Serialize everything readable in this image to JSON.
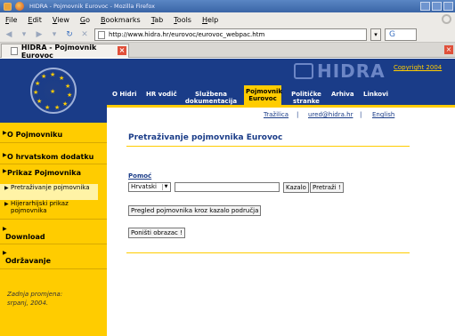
{
  "window": {
    "title": "HIDRA - Pojmovnik Eurovoc - Mozilla Firefox"
  },
  "menubar": {
    "items": [
      "File",
      "Edit",
      "View",
      "Go",
      "Bookmarks",
      "Tab",
      "Tools",
      "Help"
    ]
  },
  "navbar": {
    "url": "http://www.hidra.hr/eurovoc/eurovoc_webpac.htm"
  },
  "tab": {
    "title": "HIDRA - Pojmovnik Eurovoc"
  },
  "header": {
    "logo_text": "HIDRA",
    "copyright": "Copyright 2004",
    "nav": [
      "O Hidri",
      "HR vodič",
      "Službena dokumentacija",
      "Pojmovnik Eurovoc",
      "Političke stranke",
      "Arhiva",
      "Linkovi"
    ],
    "sublinks": [
      "Tražilica",
      "|",
      "ured@hidra.hr",
      "|",
      "English"
    ]
  },
  "sidebar": {
    "items": [
      "O Pojmovniku",
      "O hrvatskom dodatku",
      "Prikaz Pojmovnika",
      "Download",
      "Održavanje"
    ],
    "subitems": [
      "Pretraživanje pojmovnika",
      "Hijerarhijski prikaz pojmovnika"
    ],
    "note_line1": "Zadnja promjena:",
    "note_line2": "srpanj, 2004."
  },
  "main": {
    "title": "Pretraživanje pojmovnika Eurovoc",
    "help_link": "Pomoć",
    "language_select": "Hrvatski",
    "search_value": "",
    "kazalo_button": "Kazalo",
    "search_button": "Pretraži !",
    "browse_button": "Pregled pojmovnika kroz kazalo područja",
    "reset_button": "Poništi obrazac !"
  },
  "colors": {
    "brand_blue": "#1a3c88",
    "brand_yellow": "#ffcc00"
  }
}
